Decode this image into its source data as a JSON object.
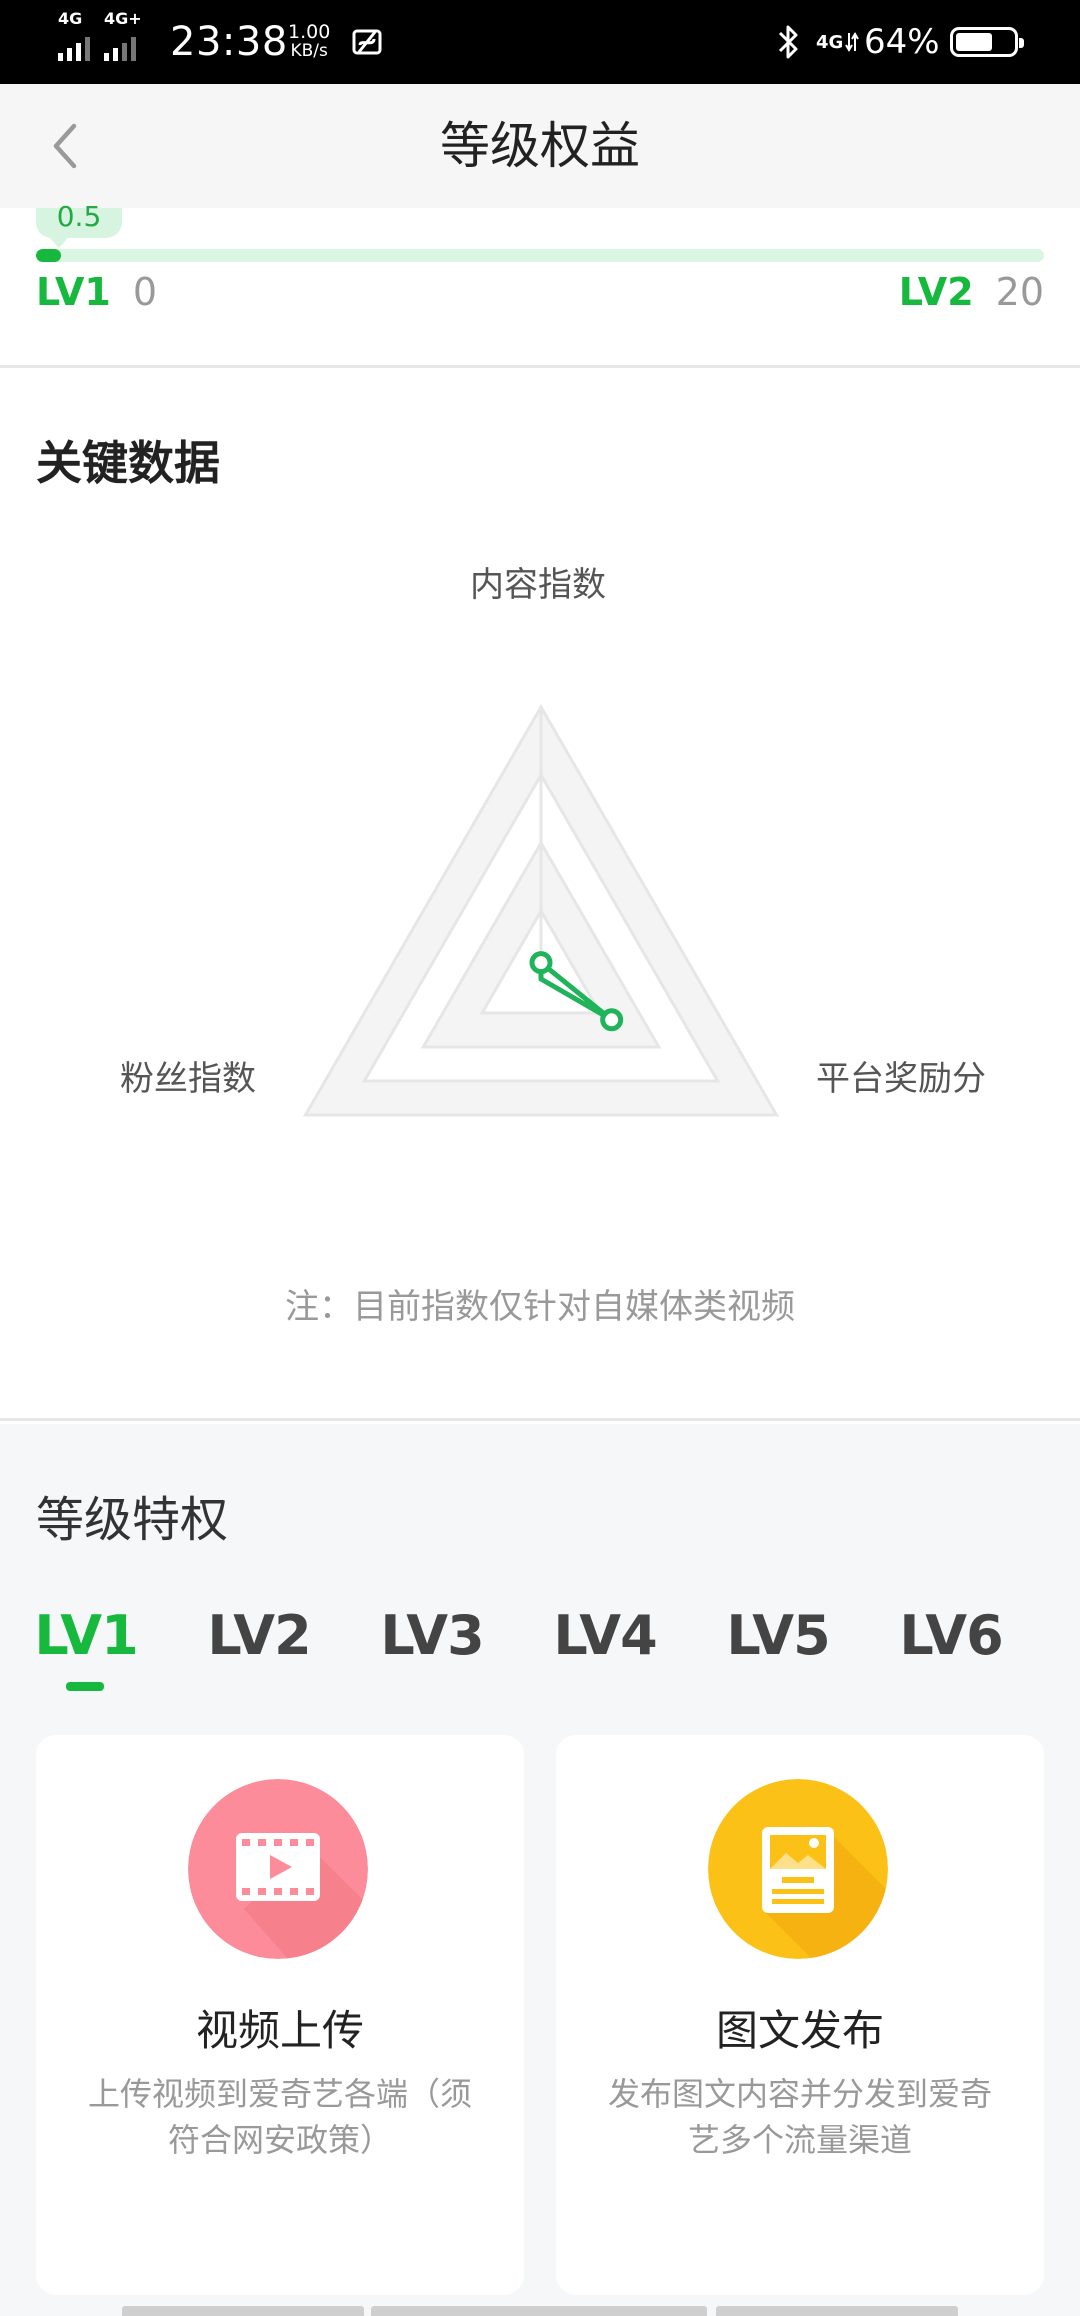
{
  "status_bar": {
    "net1": "4G",
    "net2": "4G+",
    "time": "23:38",
    "speed_value": "1.00",
    "speed_unit": "KB/s",
    "net3": "4G",
    "battery_percent": "64%",
    "battery_level": 0.64
  },
  "header": {
    "title": "等级权益"
  },
  "progress": {
    "value_label": "0.5",
    "fraction": 0.025,
    "current_level": "LV1",
    "current_points": "0",
    "next_level": "LV2",
    "next_points": "20"
  },
  "key_data": {
    "title": "关键数据",
    "axes": [
      "内容指数",
      "平台奖励分",
      "粉丝指数"
    ],
    "values": [
      0.06,
      0.3,
      0.0
    ],
    "note": "注：目前指数仅针对自媒体类视频"
  },
  "privileges": {
    "title": "等级特权",
    "tabs": [
      "LV1",
      "LV2",
      "LV3",
      "LV4",
      "LV5",
      "LV6"
    ],
    "active_tab": "LV1",
    "cards": [
      {
        "name": "视频上传",
        "desc": "上传视频到爱奇艺各端（须符合网安政策）",
        "icon": "video-icon",
        "color": "#fc8c99"
      },
      {
        "name": "图文发布",
        "desc": "发布图文内容并分发到爱奇艺多个流量渠道",
        "icon": "article-icon",
        "color": "#fbc117"
      }
    ]
  },
  "colors": {
    "accent": "#16b93d",
    "radar_line": "#1fb35a",
    "grid": "#eeeeee"
  }
}
